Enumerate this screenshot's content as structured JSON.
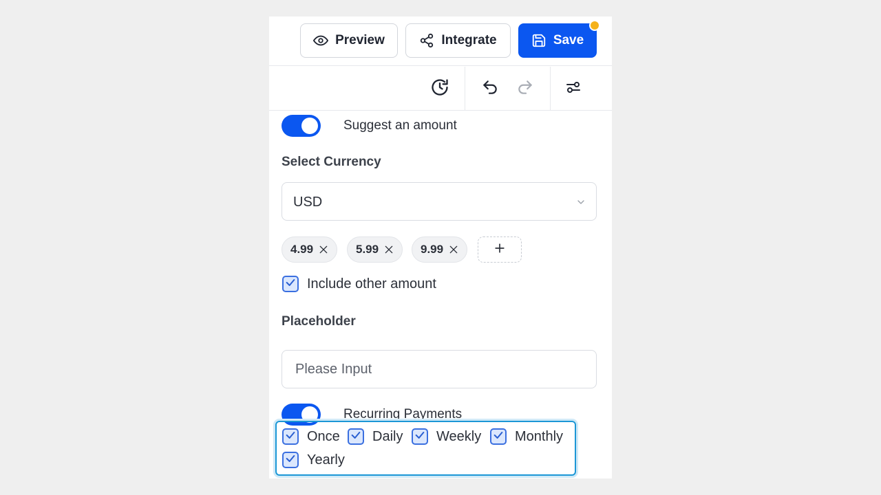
{
  "toolbar": {
    "preview_label": "Preview",
    "integrate_label": "Integrate",
    "save_label": "Save"
  },
  "icons": {
    "preview": "eye-icon",
    "integrate": "share-icon",
    "save": "floppy-disk-icon",
    "history": "clock-history-icon",
    "undo": "undo-icon",
    "redo": "redo-icon",
    "settings": "sliders-icon"
  },
  "colors": {
    "accent": "#0b57f0",
    "notification_dot": "#f5b21b",
    "focus_outline": "#1b97d6"
  },
  "suggest_amount": {
    "enabled": true,
    "label": "Suggest an amount"
  },
  "currency": {
    "label": "Select Currency",
    "value": "USD"
  },
  "amounts": [
    "4.99",
    "5.99",
    "9.99"
  ],
  "include_other": {
    "checked": true,
    "label": "Include other amount"
  },
  "placeholder_field": {
    "label": "Placeholder",
    "placeholder": "Please Input"
  },
  "recurring": {
    "enabled": true,
    "label": "Recurring Payments",
    "options": [
      {
        "label": "Once",
        "checked": true
      },
      {
        "label": "Daily",
        "checked": true
      },
      {
        "label": "Weekly",
        "checked": true
      },
      {
        "label": "Monthly",
        "checked": true
      },
      {
        "label": "Yearly",
        "checked": true
      }
    ]
  }
}
